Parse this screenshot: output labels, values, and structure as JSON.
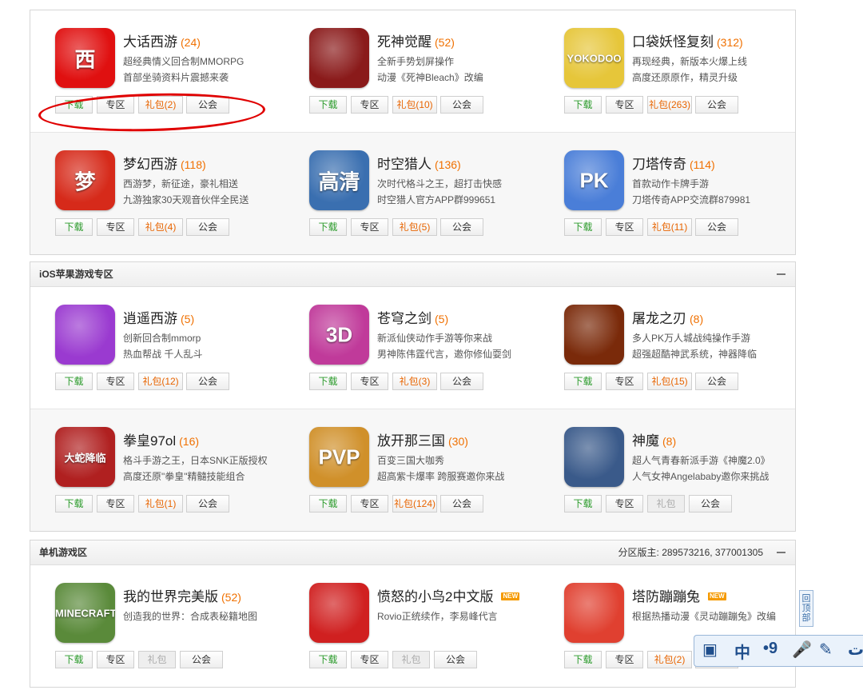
{
  "btn_labels": {
    "download": "下载",
    "zone": "专区",
    "guild": "公会"
  },
  "sections": [
    {
      "title": "",
      "rows": [
        [
          {
            "name": "大话西游",
            "count": "(24)",
            "d1": "超经典情义回合制MMORPG",
            "d2": "首部坐骑资料片震撼来袭",
            "gift": "礼包(2)",
            "icon_text": "西",
            "color": "#e01010",
            "new": ""
          },
          {
            "name": "死神觉醒",
            "count": "(52)",
            "d1": "全新手势划屏操作",
            "d2": "动漫《死神Bleach》改编",
            "gift": "礼包(10)",
            "icon_text": "",
            "color": "#8a1a1a",
            "new": ""
          },
          {
            "name": "口袋妖怪复刻",
            "count": "(312)",
            "d1": "再现经典，新版本火爆上线",
            "d2": "高度还原原作，精灵升级",
            "gift": "礼包(263)",
            "icon_text": "YOKODOO",
            "color": "#e6c63a",
            "new": ""
          }
        ],
        [
          {
            "name": "梦幻西游",
            "count": "(118)",
            "d1": "西游梦，新征途，豪礼相送",
            "d2": "九游独家30天观音伙伴全民送",
            "gift": "礼包(4)",
            "icon_text": "梦",
            "color": "#d62a1a",
            "new": ""
          },
          {
            "name": "时空猎人",
            "count": "(136)",
            "d1": "次时代格斗之王，超打击快感",
            "d2": "时空猎人官方APP群999651",
            "gift": "礼包(5)",
            "icon_text": "高清",
            "color": "#3a6fb0",
            "new": ""
          },
          {
            "name": "刀塔传奇",
            "count": "(114)",
            "d1": "首款动作卡牌手游",
            "d2": "刀塔传奇APP交流群879981",
            "gift": "礼包(11)",
            "icon_text": "PK",
            "color": "#4a7ed8",
            "new": ""
          }
        ]
      ]
    },
    {
      "title": "iOS苹果游戏专区",
      "mods": "",
      "rows": [
        [
          {
            "name": "逍遥西游",
            "count": "(5)",
            "d1": "创新回合制mmorp",
            "d2": "热血帮战 千人乱斗",
            "gift": "礼包(12)",
            "icon_text": "",
            "color": "#9a3ad0",
            "new": ""
          },
          {
            "name": "苍穹之剑",
            "count": "(5)",
            "d1": "新派仙侠动作手游等你来战",
            "d2": "男神陈伟霆代言，邀你修仙耍剑",
            "gift": "礼包(3)",
            "icon_text": "3D",
            "color": "#c03a9a",
            "new": ""
          },
          {
            "name": "屠龙之刃",
            "count": "(8)",
            "d1": "多人PK万人城战纯操作手游",
            "d2": "超强超酷神武系统，神器降临",
            "gift": "礼包(15)",
            "icon_text": "",
            "color": "#7a2a0a",
            "new": ""
          }
        ],
        [
          {
            "name": "拳皇97ol",
            "count": "(16)",
            "d1": "格斗手游之王，日本SNK正版授权",
            "d2": "高度还原\"拳皇\"精髓技能组合",
            "gift": "礼包(1)",
            "icon_text": "大蛇降临",
            "color": "#b02020",
            "new": ""
          },
          {
            "name": "放开那三国",
            "count": "(30)",
            "d1": "百变三国大咖秀",
            "d2": "超高紫卡爆率 跨服赛邀你来战",
            "gift": "礼包(124)",
            "icon_text": "PVP",
            "color": "#d0902a",
            "new": ""
          },
          {
            "name": "神魔",
            "count": "(8)",
            "d1": "超人气青春新派手游《神魔2.0》",
            "d2": "人气女神Angelababy邀你来挑战",
            "gift": "礼包",
            "icon_text": "",
            "color": "#3a5a8a",
            "new": "",
            "gift_off": true
          }
        ]
      ]
    },
    {
      "title": "单机游戏区",
      "mods": "分区版主: 289573216, 377001305",
      "rows": [
        [
          {
            "name": "我的世界完美版",
            "count": "(52)",
            "d1": "创造我的世界：合成表秘籍地图",
            "d2": "",
            "gift": "礼包",
            "icon_text": "MINECRAFT",
            "color": "#5a8a3a",
            "new": "",
            "gift_off": true
          },
          {
            "name": "愤怒的小鸟2中文版",
            "count": "",
            "d1": "Rovio正统续作，李易峰代言",
            "d2": "",
            "gift": "礼包",
            "icon_text": "",
            "color": "#d02020",
            "new": "NEW",
            "gift_off": true
          },
          {
            "name": "塔防蹦蹦兔",
            "count": "",
            "d1": "根据热播动漫《灵动蹦蹦兔》改编",
            "d2": "",
            "gift": "礼包(2)",
            "icon_text": "",
            "color": "#e04030",
            "new": "NEW"
          }
        ]
      ]
    }
  ],
  "back_to_top": "回顶部",
  "ime": {
    "c1": "中",
    "c2": "•9"
  },
  "colors": {
    "accent": "#f07000",
    "download": "#2a9a2a",
    "annotation": "#e00000"
  }
}
